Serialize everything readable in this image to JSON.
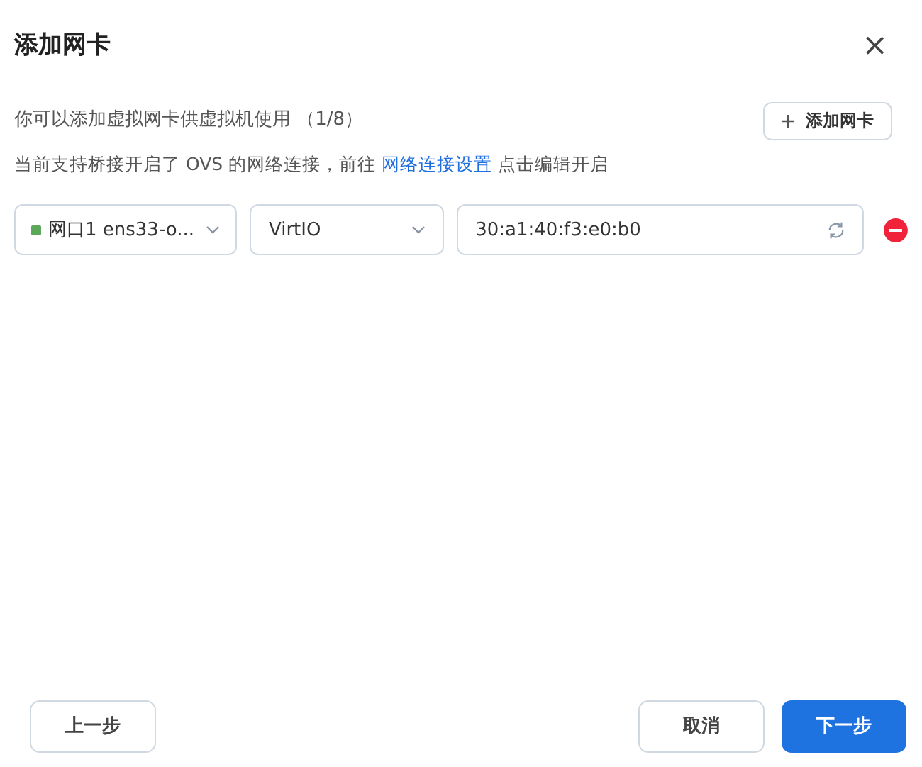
{
  "dialog": {
    "title": "添加网卡",
    "close": "×"
  },
  "info": {
    "text": "你可以添加虚拟网卡供虚拟机使用 （1/8）",
    "add_button": "添加网卡",
    "note_before": "当前支持桥接开启了 OVS 的网络连接，前往",
    "note_link": "网络连接设置",
    "note_after": "点击编辑开启"
  },
  "nics": [
    {
      "port": "网口1 ens33-o...",
      "color": "#5ba85a",
      "model": "VirtIO",
      "mac": "30:a1:40:f3:e0:b0"
    }
  ],
  "footer": {
    "back": "上一步",
    "cancel": "取消",
    "next": "下一步"
  }
}
